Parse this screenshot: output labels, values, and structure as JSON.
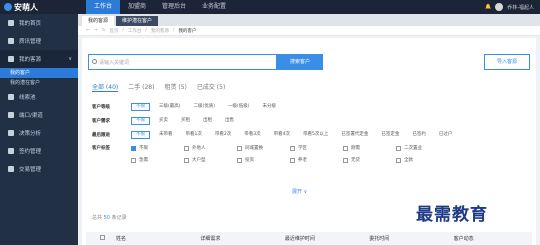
{
  "app": {
    "brand": "安萌人"
  },
  "topnav": [
    "工作台",
    "加盟商",
    "管理后台",
    "业务配置"
  ],
  "user": {
    "name": "乔林-福起人"
  },
  "sidebar": {
    "items": [
      "我的首页",
      "质讯管理",
      "我的客源",
      "线索池",
      "端口/渠道",
      "决策分析",
      "签约管理",
      "交易管理"
    ],
    "subs": [
      "我的客户",
      "我的潜在客户"
    ]
  },
  "tabs": [
    "我的客源",
    "维护潜在客户"
  ],
  "breadcrumb": [
    "首页",
    "工作台",
    "我的客源",
    "我的客户"
  ],
  "search": {
    "placeholder": "请输入关键词",
    "button": "搜索客户",
    "import": "导入客源"
  },
  "subtabs": [
    "全部 (40)",
    "二手 (28)",
    "租赁 (5)",
    "已成交 (5)"
  ],
  "filters": [
    {
      "label": "客户等级",
      "chips": [
        "不限",
        "三级(最高)",
        "二级(优质)",
        "一级(低级)",
        "未分级"
      ]
    },
    {
      "label": "客户需求",
      "chips": [
        "不限",
        "买卖",
        "买租",
        "出租",
        "出售"
      ]
    },
    {
      "label": "最后跟进",
      "chips": [
        "不限",
        "未带看",
        "带看1次",
        "带看2次",
        "带看3次",
        "带看4次",
        "带看5次以上",
        "已签署代定金",
        "已签定金",
        "已签约",
        "已过户"
      ]
    }
  ],
  "tags": {
    "label": "客户标签",
    "items": [
      "不限",
      "外地人",
      "同城置换",
      "学区",
      "刚需",
      "二次置业",
      "急需",
      "大户型",
      "投资",
      "养老",
      "无贷",
      "全款"
    ]
  },
  "more": "展开 ∨",
  "total": {
    "prefix": "总共",
    "count": "50",
    "suffix": "条记录"
  },
  "table": {
    "headers": [
      "姓名",
      "详细需求",
      "最近维护时间",
      "委托时间",
      "客户动态"
    ]
  },
  "watermark": "最需教育"
}
